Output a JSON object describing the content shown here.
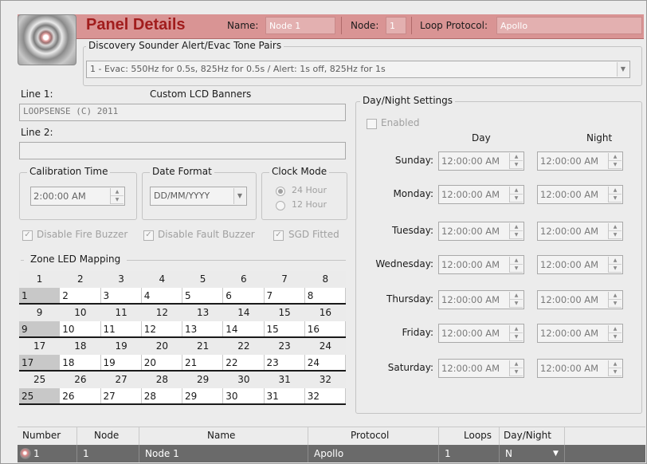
{
  "header": {
    "title": "Panel Details",
    "name_label": "Name:",
    "name_value": "Node 1",
    "node_label": "Node:",
    "node_value": "1",
    "loop_protocol_label": "Loop Protocol:",
    "loop_protocol_value": "Apollo"
  },
  "tone_pairs": {
    "title": "Discovery Sounder Alert/Evac Tone Pairs",
    "selected": "1 - Evac: 550Hz for 0.5s, 825Hz for 0.5s / Alert: 1s off, 825Hz for 1s"
  },
  "lcd": {
    "line1_label": "Line 1:",
    "banners_title": "Custom LCD Banners",
    "line1_value": "LOOPSENSE (C) 2011",
    "line2_label": "Line 2:",
    "line2_value": ""
  },
  "calibration": {
    "title": "Calibration Time",
    "value": "2:00:00 AM"
  },
  "date_format": {
    "title": "Date Format",
    "value": "DD/MM/YYYY"
  },
  "clock_mode": {
    "title": "Clock Mode",
    "opt24": "24 Hour",
    "opt12": "12 Hour"
  },
  "options": {
    "disable_fire": "Disable Fire Buzzer",
    "disable_fault": "Disable Fault Buzzer",
    "sgd_fitted": "SGD Fitted"
  },
  "zone": {
    "title": "Zone LED Mapping",
    "rows": [
      {
        "header": [
          "1",
          "2",
          "3",
          "4",
          "5",
          "6",
          "7",
          "8"
        ],
        "cells": [
          "1",
          "2",
          "3",
          "4",
          "5",
          "6",
          "7",
          "8"
        ]
      },
      {
        "header": [
          "9",
          "10",
          "11",
          "12",
          "13",
          "14",
          "15",
          "16"
        ],
        "cells": [
          "9",
          "10",
          "11",
          "12",
          "13",
          "14",
          "15",
          "16"
        ]
      },
      {
        "header": [
          "17",
          "18",
          "19",
          "20",
          "21",
          "22",
          "23",
          "24"
        ],
        "cells": [
          "17",
          "18",
          "19",
          "20",
          "21",
          "22",
          "23",
          "24"
        ]
      },
      {
        "header": [
          "25",
          "26",
          "27",
          "28",
          "29",
          "30",
          "31",
          "32"
        ],
        "cells": [
          "25",
          "26",
          "27",
          "28",
          "29",
          "30",
          "31",
          "32"
        ]
      }
    ]
  },
  "daynight": {
    "title": "Day/Night Settings",
    "enabled_label": "Enabled",
    "day_header": "Day",
    "night_header": "Night",
    "days": [
      {
        "name": "Sunday:",
        "day": "12:00:00 AM",
        "night": "12:00:00 AM"
      },
      {
        "name": "Monday:",
        "day": "12:00:00 AM",
        "night": "12:00:00 AM"
      },
      {
        "name": "Tuesday:",
        "day": "12:00:00 AM",
        "night": "12:00:00 AM"
      },
      {
        "name": "Wednesday:",
        "day": "12:00:00 AM",
        "night": "12:00:00 AM"
      },
      {
        "name": "Thursday:",
        "day": "12:00:00 AM",
        "night": "12:00:00 AM"
      },
      {
        "name": "Friday:",
        "day": "12:00:00 AM",
        "night": "12:00:00 AM"
      },
      {
        "name": "Saturday:",
        "day": "12:00:00 AM",
        "night": "12:00:00 AM"
      }
    ]
  },
  "table": {
    "columns": [
      "Number",
      "Node",
      "Name",
      "Protocol",
      "Loops",
      "Day/Night"
    ],
    "row": {
      "number": "1",
      "node": "1",
      "name": "Node 1",
      "protocol": "Apollo",
      "loops": "1",
      "daynight": "N"
    }
  }
}
